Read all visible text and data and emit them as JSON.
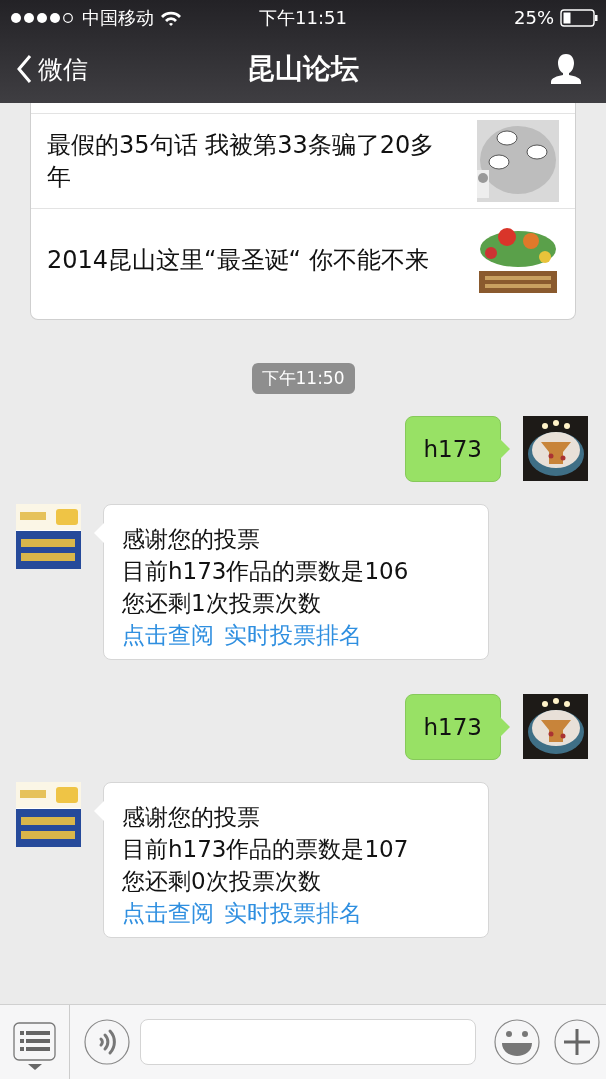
{
  "status_bar": {
    "carrier": "中国移动",
    "time": "下午11:51",
    "battery": "25%"
  },
  "nav": {
    "back": "微信",
    "title": "昆山论坛"
  },
  "articles": [
    {
      "title": "最假的35句话 我被第33条骗了20多年",
      "kind": "picture"
    },
    {
      "title": "2014昆山这里“最圣诞“ 你不能不来",
      "kind": "picture"
    }
  ],
  "timestamp": "下午11:50",
  "messages": [
    {
      "kind": "sent",
      "lines": [
        "h173"
      ]
    },
    {
      "kind": "received",
      "lines": [
        "感谢您的投票",
        "目前h173作品的票数是106",
        "您还剩1次投票次数"
      ],
      "links": [
        "点击查阅",
        "实时投票排名"
      ]
    },
    {
      "kind": "sent",
      "lines": [
        "h173"
      ]
    },
    {
      "kind": "received",
      "lines": [
        "感谢您的投票",
        "目前h173作品的票数是107",
        "您还剩0次投票次数"
      ],
      "links": [
        "点击查阅",
        "实时投票排名"
      ]
    }
  ]
}
